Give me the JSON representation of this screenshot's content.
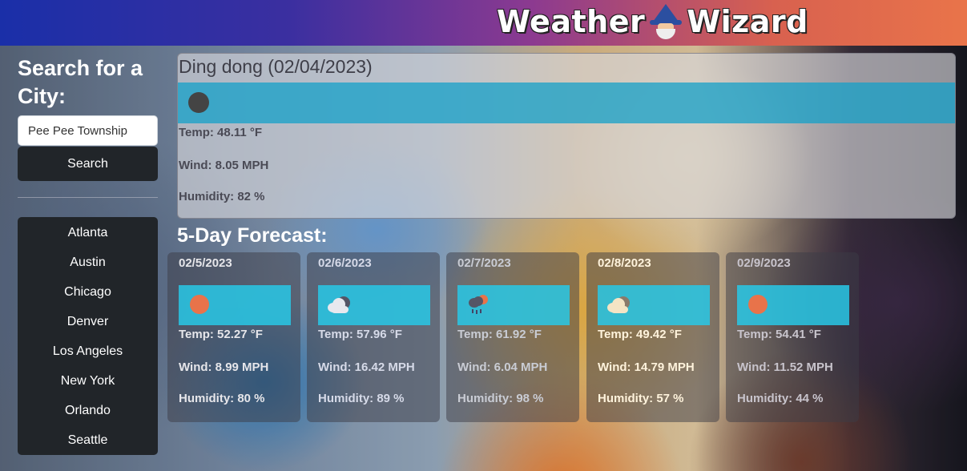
{
  "header": {
    "brand_left": "Weather",
    "brand_right": "Wizard"
  },
  "sidebar": {
    "search_title": "Search for a City:",
    "search_value": "Pee Pee Township",
    "search_button": "Search",
    "history": [
      "Atlanta",
      "Austin",
      "Chicago",
      "Denver",
      "Los Angeles",
      "New York",
      "Orlando",
      "Seattle"
    ]
  },
  "current": {
    "title": "Ding dong (02/04/2023)",
    "icon": "moon-icon",
    "temp": "Temp: 48.11 °F",
    "wind": "Wind: 8.05 MPH",
    "humidity": "Humidity: 82 %"
  },
  "forecast": {
    "title": "5-Day Forecast:",
    "days": [
      {
        "date": "02/5/2023",
        "icon": "sun-icon",
        "temp": "Temp: 52.27 °F",
        "wind": "Wind: 8.99 MPH",
        "humidity": "Humidity: 80 %",
        "text_color": "#e6e6ea"
      },
      {
        "date": "02/6/2023",
        "icon": "cloudy-icon",
        "temp": "Temp: 57.96 °F",
        "wind": "Wind: 16.42 MPH",
        "humidity": "Humidity: 89 %",
        "text_color": "#d6dae8"
      },
      {
        "date": "02/7/2023",
        "icon": "rain-icon",
        "temp": "Temp: 61.92 °F",
        "wind": "Wind: 6.04 MPH",
        "humidity": "Humidity: 98 %",
        "text_color": "#c9ccd4"
      },
      {
        "date": "02/8/2023",
        "icon": "partly-cloudy-icon",
        "temp": "Temp: 49.42 °F",
        "wind": "Wind: 14.79 MPH",
        "humidity": "Humidity: 57 %",
        "text_color": "#fff3dc"
      },
      {
        "date": "02/9/2023",
        "icon": "sun-icon",
        "temp": "Temp: 54.41 °F",
        "wind": "Wind: 11.52 MPH",
        "humidity": "Humidity: 44 %",
        "text_color": "#c8c4cc"
      }
    ]
  }
}
